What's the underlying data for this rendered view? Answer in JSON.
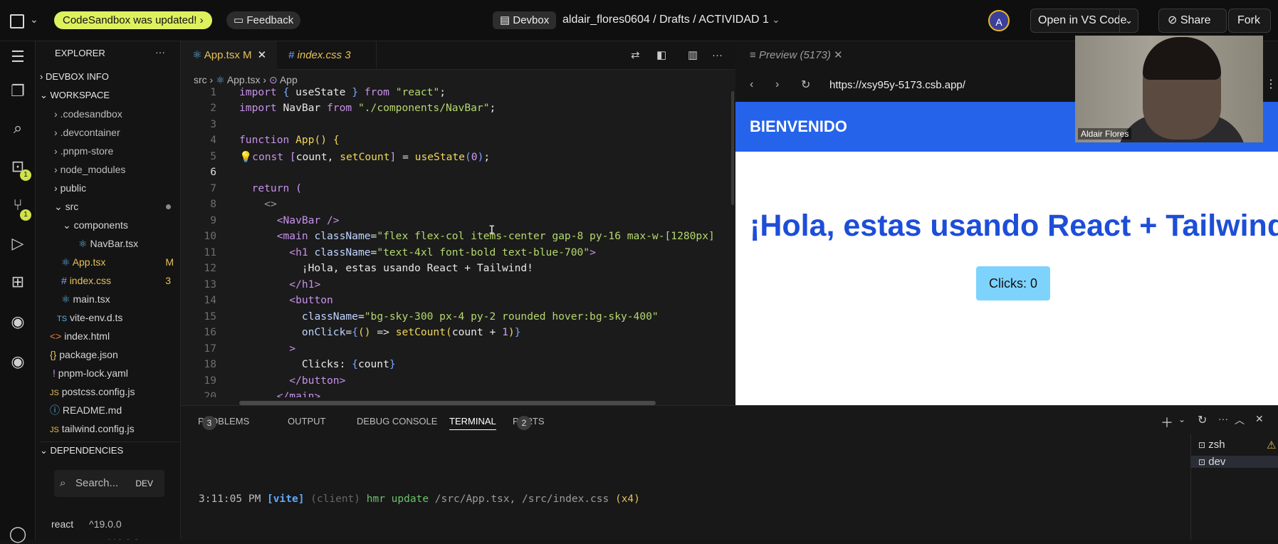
{
  "topbar": {
    "update_pill": "CodeSandbox was updated!",
    "feedback_label": "Feedback",
    "devbox_label": "Devbox",
    "breadcrumb": "aldair_flores0604 / Drafts / ACTIVIDAD 1",
    "avatar_letter": "A",
    "open_vscode_label": "Open in VS Code",
    "share_label": "Share",
    "fork_label": "Fork"
  },
  "activity_bar": {
    "badges": [
      "1",
      "1"
    ]
  },
  "explorer": {
    "title": "EXPLORER",
    "sections": [
      "DEVBOX INFO",
      "WORKSPACE",
      "DEPENDENCIES"
    ],
    "items": [
      {
        "label": ".codesandbox",
        "kind": "folder"
      },
      {
        "label": ".devcontainer",
        "kind": "folder"
      },
      {
        "label": ".pnpm-store",
        "kind": "folder"
      },
      {
        "label": "node_modules",
        "kind": "folder"
      },
      {
        "label": "public",
        "kind": "folder"
      },
      {
        "label": "src",
        "kind": "folder-open"
      },
      {
        "label": "components",
        "kind": "folder-open"
      },
      {
        "label": "NavBar.tsx",
        "kind": "file"
      },
      {
        "label": "App.tsx",
        "kind": "file",
        "status": "M"
      },
      {
        "label": "index.css",
        "kind": "file",
        "status": "3"
      },
      {
        "label": "main.tsx",
        "kind": "file"
      },
      {
        "label": "vite-env.d.ts",
        "kind": "file"
      },
      {
        "label": "index.html",
        "kind": "file"
      },
      {
        "label": "package.json",
        "kind": "file"
      },
      {
        "label": "pnpm-lock.yaml",
        "kind": "file"
      },
      {
        "label": "postcss.config.js",
        "kind": "file"
      },
      {
        "label": "README.md",
        "kind": "file"
      },
      {
        "label": "tailwind.config.js",
        "kind": "file"
      }
    ],
    "search_placeholder": "Search...",
    "search_tag": "DEV",
    "dependency": {
      "name": "react",
      "version": "^19.0.0"
    },
    "dependency_partial": "^19.0.0"
  },
  "editor": {
    "tabs": [
      {
        "label": "App.tsx",
        "status": "M"
      },
      {
        "label": "index.css",
        "status": "3"
      }
    ],
    "breadcrumb": [
      "src",
      "App.tsx",
      "App"
    ],
    "line_numbers": [
      "1",
      "2",
      "3",
      "4",
      "5",
      "6",
      "7",
      "8",
      "9",
      "10",
      "11",
      "12",
      "13",
      "14",
      "15",
      "16",
      "17",
      "18",
      "19",
      "20"
    ]
  },
  "preview": {
    "tab_label": "Preview (5173)",
    "url": "https://xsy95y-5173.csb.app/",
    "navbar_title": "BIENVENIDO",
    "heading": "¡Hola, estas usando React + Tailwind!",
    "button_label": "Clicks: 0",
    "camera_name": "Aldair Flores"
  },
  "panel": {
    "tabs": [
      {
        "label": "PROBLEMS",
        "count": "3"
      },
      {
        "label": "OUTPUT"
      },
      {
        "label": "DEBUG CONSOLE"
      },
      {
        "label": "TERMINAL",
        "active": true
      },
      {
        "label": "PORTS",
        "count": "2"
      }
    ],
    "terminal_line": {
      "time": "3:11:05 PM",
      "tag": "[vite]",
      "scope": "(client)",
      "action": "hmr update",
      "files": "/src/App.tsx, /src/index.css",
      "count": "(x4)"
    },
    "terminals": [
      "zsh",
      "dev"
    ]
  },
  "colors": {
    "accent_yellow": "#ddf15f",
    "nav_blue": "#2563eb",
    "heading_blue": "#1d4ed8",
    "button_sky": "#7dd3fc"
  }
}
